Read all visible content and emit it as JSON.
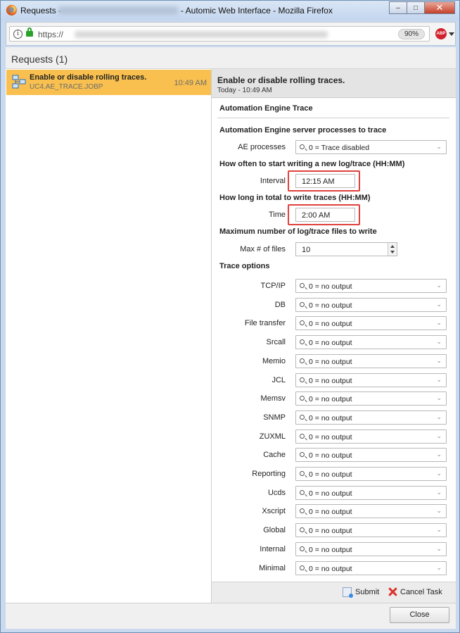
{
  "window": {
    "title_prefix": "Requests -",
    "title_suffix": "- Automic Web Interface - Mozilla Firefox",
    "minimize": "–",
    "maximize": "□",
    "close": "✕"
  },
  "browser": {
    "url": "https://",
    "zoom": "90%",
    "adblock_label": "ABP"
  },
  "requests": {
    "header": "Requests (1)",
    "items": [
      {
        "title": "Enable or disable rolling traces.",
        "subtitle": "UC4.AE_TRACE.JOBP",
        "time": "10:49 AM",
        "icon": "workflow-icon"
      }
    ]
  },
  "detail": {
    "title": "Enable or disable rolling traces.",
    "subtitle": "Today - 10:49 AM",
    "section_title": "Automation Engine Trace",
    "group_processes": "Automation Engine server processes to trace",
    "ae_processes_label": "AE processes",
    "ae_processes_value": "0 = Trace disabled",
    "group_interval": "How often to start writing a new log/trace (HH:MM)",
    "interval_label": "Interval",
    "interval_value": "12:15 AM",
    "group_time": "How long in total to write traces (HH:MM)",
    "time_label": "Time",
    "time_value": "2:00 AM",
    "group_max": "Maximum number of log/trace files to write",
    "max_label": "Max # of files",
    "max_value": "10",
    "group_trace_options": "Trace options",
    "trace_options": [
      {
        "label": "TCP/IP",
        "value": "0 = no output"
      },
      {
        "label": "DB",
        "value": "0 = no output"
      },
      {
        "label": "File transfer",
        "value": "0 = no output"
      },
      {
        "label": "Srcall",
        "value": "0 = no output"
      },
      {
        "label": "Memio",
        "value": "0 = no output"
      },
      {
        "label": "JCL",
        "value": "0 = no output"
      },
      {
        "label": "Memsv",
        "value": "0 = no output"
      },
      {
        "label": "SNMP",
        "value": "0 = no output"
      },
      {
        "label": "ZUXML",
        "value": "0 = no output"
      },
      {
        "label": "Cache",
        "value": "0 = no output"
      },
      {
        "label": "Reporting",
        "value": "0 = no output"
      },
      {
        "label": "Ucds",
        "value": "0 = no output"
      },
      {
        "label": "Xscript",
        "value": "0 = no output"
      },
      {
        "label": "Global",
        "value": "0 = no output"
      },
      {
        "label": "Internal",
        "value": "0 = no output"
      },
      {
        "label": "Minimal",
        "value": "0 = no output"
      }
    ],
    "submit_label": "Submit",
    "cancel_label": "Cancel Task"
  },
  "footer": {
    "close_label": "Close"
  },
  "colors": {
    "selected_item": "#f9c04f",
    "highlight_border": "#e0403a",
    "window_frame": "#c9d9ee"
  }
}
